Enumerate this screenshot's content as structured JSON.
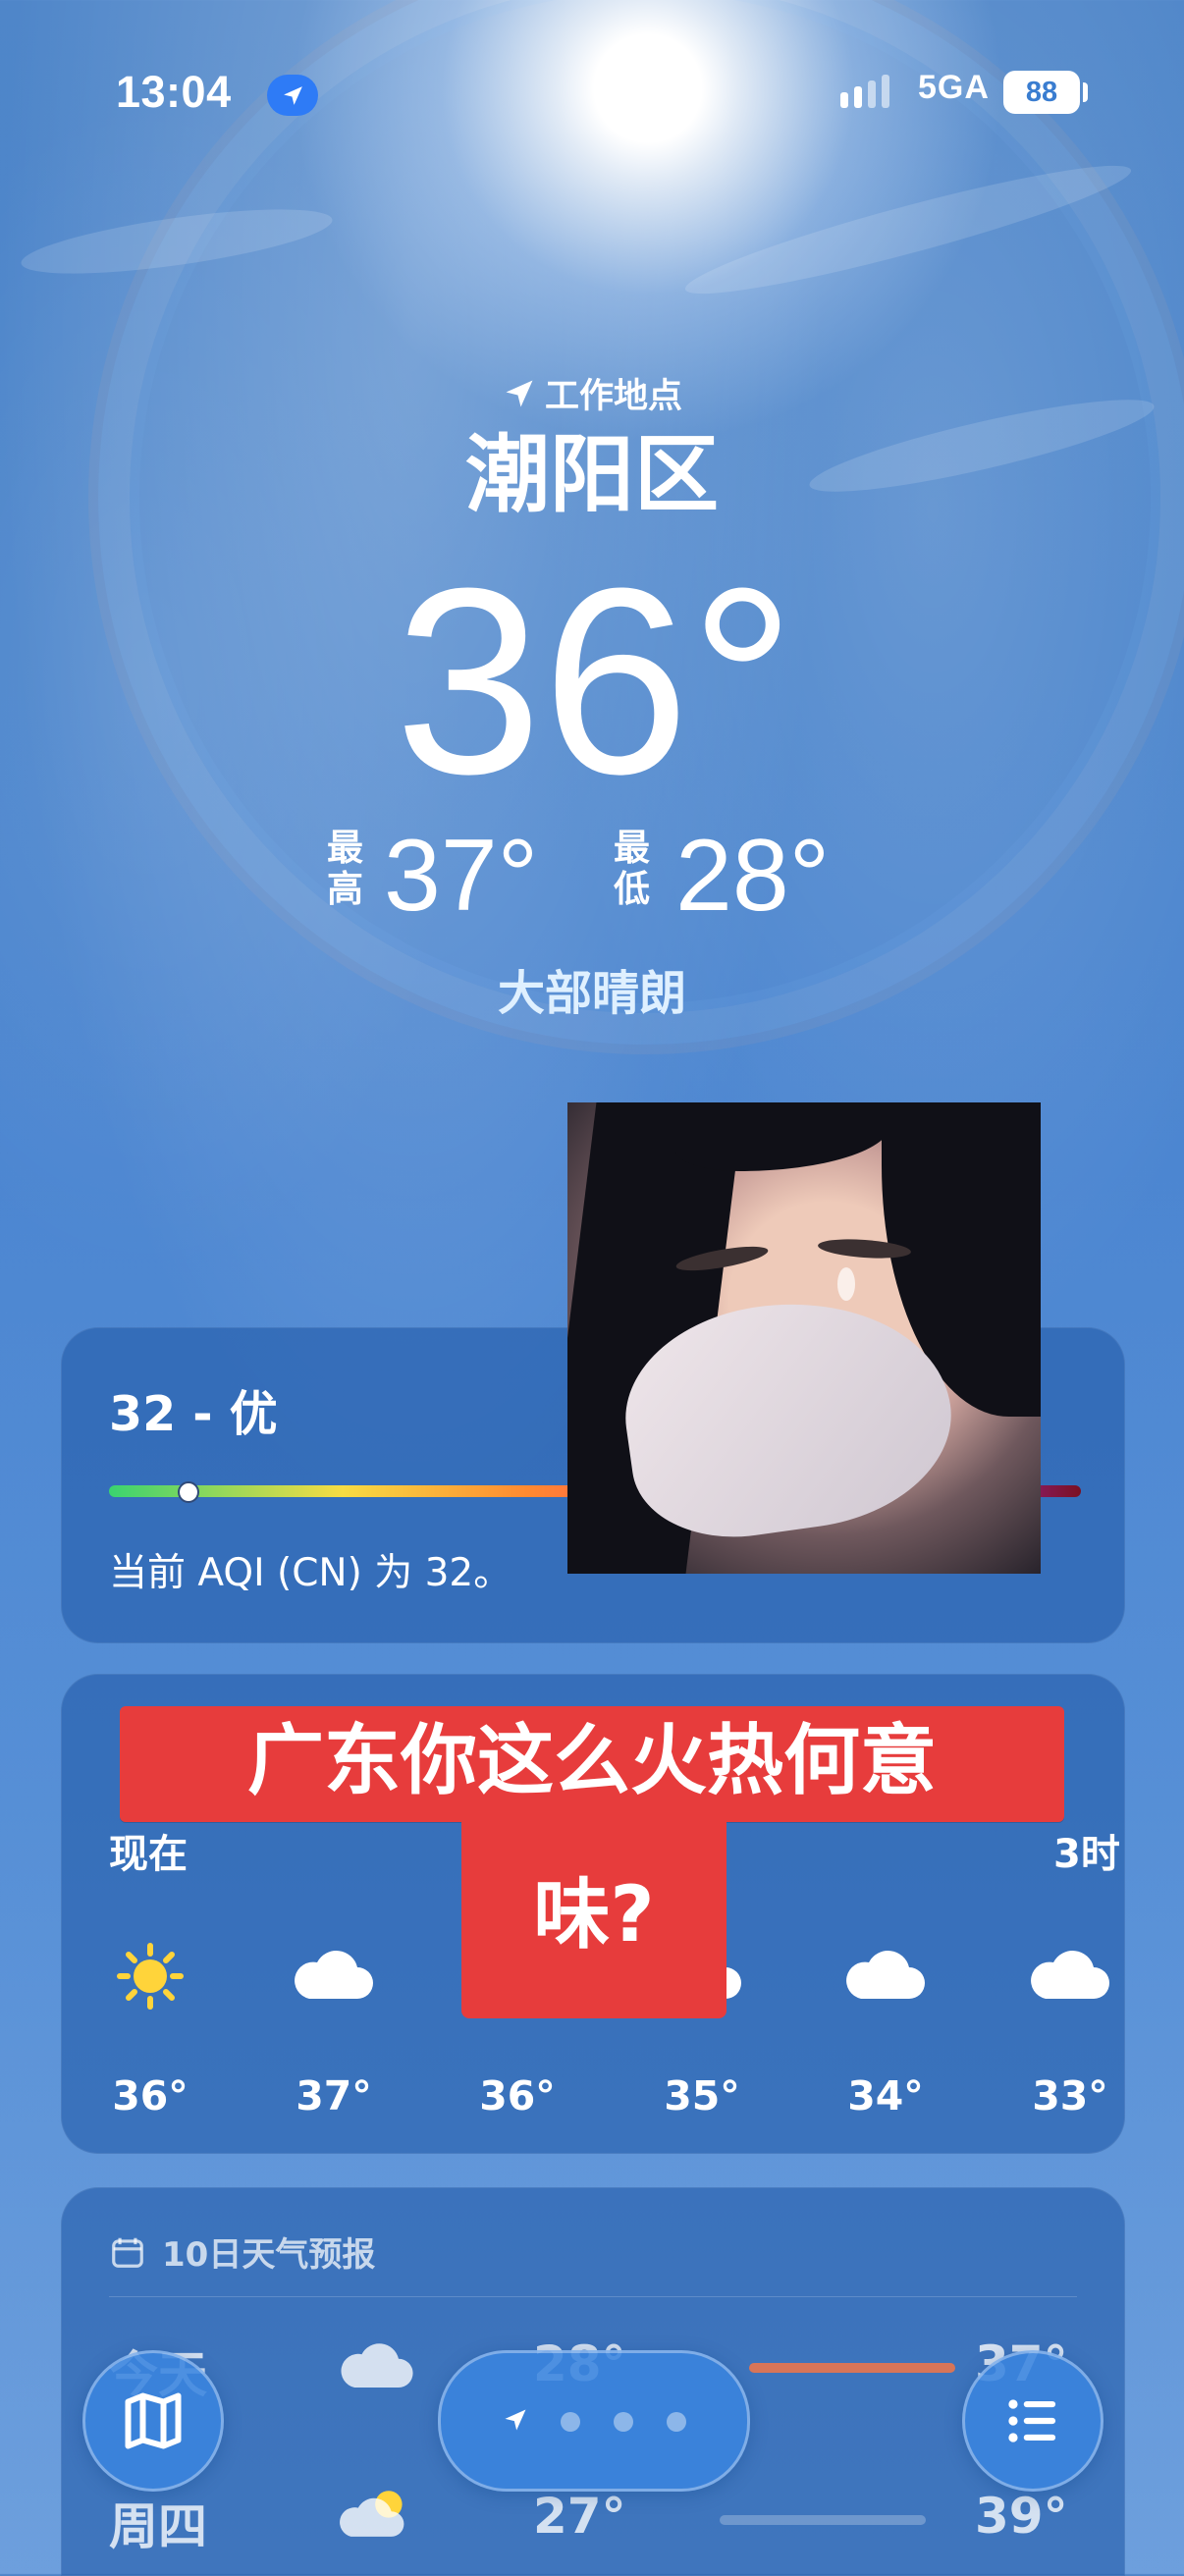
{
  "status": {
    "time": "13:04",
    "network": "5GA",
    "battery": "88"
  },
  "location": {
    "label": "工作地点",
    "city": "潮阳区",
    "temperature": "36°",
    "high_label": "最高",
    "high": "37°",
    "low_label": "最低",
    "low": "28°",
    "condition": "大部晴朗"
  },
  "aqi": {
    "title": "32 - 优",
    "value": 32,
    "description": "当前 AQI (CN) 为 32。"
  },
  "hourly": {
    "labels": [
      "现在",
      "3时"
    ],
    "items": [
      {
        "icon": "sun-icon",
        "temp": "36°"
      },
      {
        "icon": "cloud-icon",
        "temp": "37°"
      },
      {
        "icon": "cloud-icon",
        "temp": "36°"
      },
      {
        "icon": "cloud-icon",
        "temp": "35°"
      },
      {
        "icon": "cloud-icon",
        "temp": "34°"
      },
      {
        "icon": "cloud-icon",
        "temp": "33°"
      }
    ]
  },
  "forecast": {
    "title": "10日天气预报",
    "rows": [
      {
        "day": "今天",
        "low": "28°",
        "high": "37°",
        "icon": "cloud-icon"
      },
      {
        "day": "周四",
        "low": "27°",
        "high": "39°",
        "icon": "partly-sunny-icon"
      }
    ]
  },
  "overlay": {
    "caption_line1": "广东你这么火热何意",
    "caption_line2": "味?"
  },
  "colors": {
    "caption_bg": "#e73c3c",
    "sky_blue": "#4a84cb"
  }
}
